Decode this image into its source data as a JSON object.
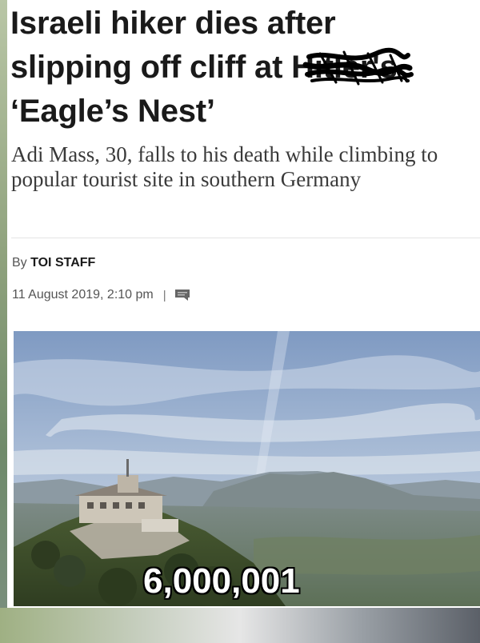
{
  "headline": {
    "line1": "Israeli hiker dies after",
    "line2_prefix": "slipping off cliff at ",
    "line2_redacted": "Hitler's",
    "line3": "‘Eagle’s Nest’"
  },
  "subheadline": "Adi Mass, 30, falls to his death while climbing to popular tourist site in southern Germany",
  "byline": {
    "prefix": "By",
    "author": "TOI STAFF"
  },
  "dateline": {
    "date": "11 August 2019, 2:10 pm",
    "separator": "|",
    "comment_icon": "comment-icon"
  },
  "photo": {
    "subject": "mountaintop-building-landscape",
    "caption": "6,000,001"
  },
  "colors": {
    "headline": "#1a1a1a",
    "subhead": "#3a3a3a",
    "meta": "#555555",
    "caption_fill": "#ffffff",
    "caption_outline": "#000000"
  }
}
